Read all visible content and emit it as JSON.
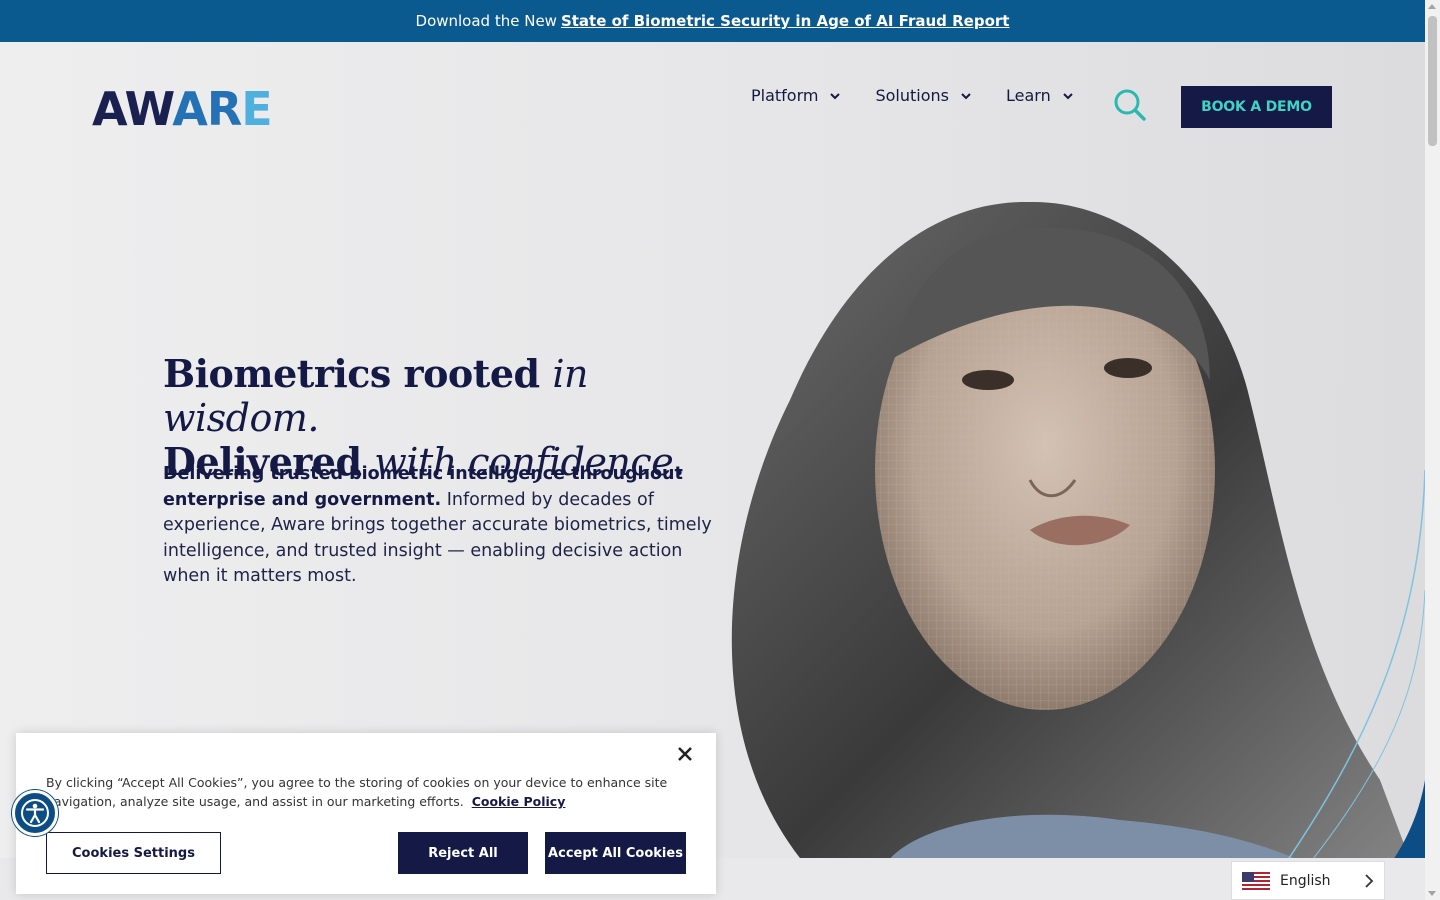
{
  "announcement": {
    "prefix": "Download the New",
    "link": "State of Biometric Security in Age of AI Fraud Report"
  },
  "header": {
    "logo_text": "AWARE",
    "nav": [
      {
        "label": "Platform"
      },
      {
        "label": "Solutions"
      },
      {
        "label": "Learn"
      }
    ],
    "search_icon": "search-icon",
    "cta": "BOOK A DEMO"
  },
  "hero": {
    "line1_bold": "Biometrics rooted",
    "line1_italic": "in wisdom.",
    "line2_bold": "Delivered",
    "line2_italic": "with confidence.",
    "sub_bold": "Delivering trusted biometric intelligence throughout enterprise and government.",
    "sub_rest": "Informed by decades of experience, Aware brings together accurate biometrics, timely intelligence, and trusted insight — enabling decisive action when it matters most."
  },
  "cookie": {
    "text": "By clicking “Accept All Cookies”, you agree to the storing of cookies on your device to enhance site navigation, analyze site usage, and assist in our marketing efforts.",
    "policy_link": "Cookie Policy",
    "settings": "Cookies Settings",
    "reject": "Reject All",
    "accept": "Accept All Cookies"
  },
  "language": {
    "current": "English"
  },
  "colors": {
    "navy": "#141945",
    "teal": "#3fd3c6",
    "topbar": "#0a5a8f"
  }
}
